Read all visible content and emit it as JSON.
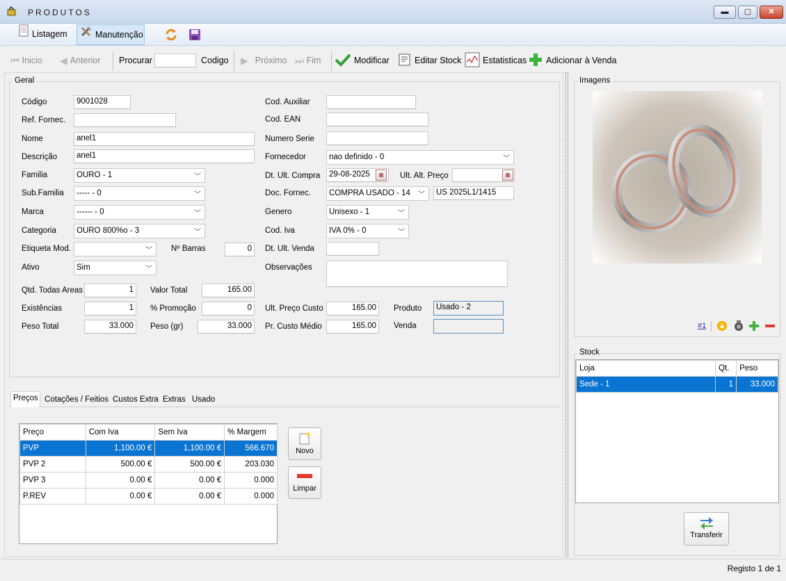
{
  "window": {
    "title": "PRODUTOS",
    "controls": {
      "minimize": "▬",
      "maximize": "▢",
      "close": "✕"
    }
  },
  "toolbar": {
    "listagem_label": "Listagem",
    "manutencao_label": "Manutenção"
  },
  "nav": {
    "inicio": "Inicio",
    "anterior": "Anterior",
    "procurar": "Procurar",
    "procurar_value": "",
    "codigo": "Codigo",
    "proximo": "Próximo",
    "fim": "Fim",
    "modificar": "Modificar",
    "editar_stock": "Editar Stock",
    "estatisticas": "Estatisticas",
    "adicionar_venda": "Adicionar à Venda"
  },
  "geral": {
    "title": "Geral",
    "codigo": {
      "label": "Código",
      "value": "9001028"
    },
    "ref_fornec": {
      "label": "Ref. Fornec.",
      "value": ""
    },
    "nome": {
      "label": "Nome",
      "value": "anel1"
    },
    "descricao": {
      "label": "Descrição",
      "value": "anel1"
    },
    "familia": {
      "label": "Familia",
      "value": "OURO - 1"
    },
    "sub_familia": {
      "label": "Sub.Familia",
      "value": "----- - 0"
    },
    "marca": {
      "label": "Marca",
      "value": "------ - 0"
    },
    "categoria": {
      "label": "Categoria",
      "value": "OURO 800%o - 3"
    },
    "etiqueta_mod": {
      "label": "Etiqueta Mod.",
      "value": ""
    },
    "n_barras": {
      "label": "Nº Barras",
      "value": "0"
    },
    "ativo": {
      "label": "Ativo",
      "value": "Sim"
    },
    "cod_auxiliar": {
      "label": "Cod. Auxiliar",
      "value": ""
    },
    "cod_ean": {
      "label": "Cod. EAN",
      "value": ""
    },
    "numero_serie": {
      "label": "Numero Serie",
      "value": ""
    },
    "fornecedor": {
      "label": "Fornecedor",
      "value": "nao definido - 0"
    },
    "dt_ult_compra": {
      "label": "Dt. Ult. Compra",
      "value": "29-08-2025"
    },
    "ult_alt_preco": {
      "label": "Ult. Alt. Preço",
      "value": ""
    },
    "doc_fornec": {
      "label": "Doc. Fornec.",
      "value": "COMPRA USADO - 14",
      "ref": "US 2025L1/1415"
    },
    "genero": {
      "label": "Genero",
      "value": "Unisexo - 1"
    },
    "cod_iva": {
      "label": "Cod. Iva",
      "value": "IVA 0% - 0"
    },
    "dt_ult_venda": {
      "label": "Dt. Ult. Venda",
      "value": ""
    },
    "observacoes": {
      "label": "Observações",
      "value": ""
    },
    "qtd_todas_areas": {
      "label": "Qtd. Todas Areas",
      "value": "1"
    },
    "valor_total": {
      "label": "Valor Total",
      "value": "165.00"
    },
    "existencias": {
      "label": "Existências",
      "value": "1"
    },
    "promocao": {
      "label": "% Promoção",
      "value": "0"
    },
    "peso_total": {
      "label": "Peso Total",
      "value": "33.000"
    },
    "peso_gr": {
      "label": "Peso (gr)",
      "value": "33.000"
    },
    "ult_preco_custo": {
      "label": "Ult. Preço Custo",
      "value": "165.00"
    },
    "pr_custo_medio": {
      "label": "Pr. Custo Médio",
      "value": "165.00"
    },
    "produto": {
      "label": "Produto",
      "value": "Usado - 2"
    },
    "venda": {
      "label": "Venda",
      "value": ""
    }
  },
  "tabs": [
    {
      "label": "Preços"
    },
    {
      "label": "Cotações / Feitios"
    },
    {
      "label": "Custos Extra"
    },
    {
      "label": "Extras"
    },
    {
      "label": "Usado"
    }
  ],
  "precos": {
    "headers": [
      "Preço",
      "Com Iva",
      "Sem Iva",
      "% Margem"
    ],
    "rows": [
      [
        "PVP",
        "1,100.00 €",
        "1,100.00 €",
        "566.670"
      ],
      [
        "PVP 2",
        "500.00 €",
        "500.00 €",
        "203.030"
      ],
      [
        "PVP 3",
        "0.00 €",
        "0.00 €",
        "0.000"
      ],
      [
        "P.REV",
        "0.00 €",
        "0.00 €",
        "0.000"
      ]
    ],
    "novo": "Novo",
    "limpar": "Limpar"
  },
  "imagens": {
    "title": "Imagens",
    "counter": "#1"
  },
  "stock": {
    "title": "Stock",
    "headers": [
      "Loja",
      "Qt.",
      "Peso"
    ],
    "rows": [
      [
        "Sede  - 1",
        "1",
        "33.000"
      ]
    ],
    "transferir": "Transferir"
  },
  "status": {
    "registo": "Registo 1 de 1"
  },
  "colors": {
    "selection": "#0a74d2",
    "accent_green": "#2ea12e"
  }
}
